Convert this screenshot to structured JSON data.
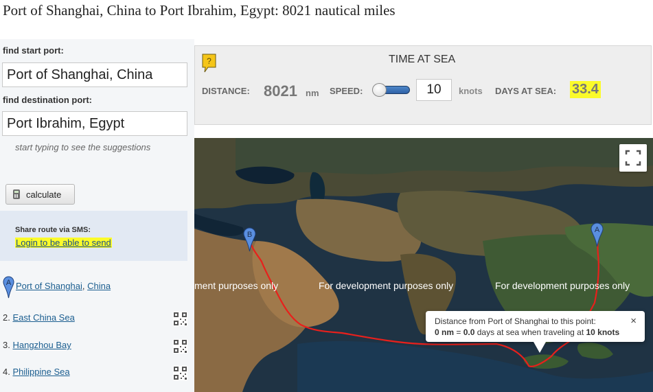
{
  "header": {
    "title": "Port of Shanghai, China to Port Ibrahim, Egypt: 8021 nautical miles"
  },
  "sidebar": {
    "start_label": "find start port:",
    "start_value": "Port of Shanghai, China",
    "destination_label": "find destination port:",
    "destination_value": "Port Ibrahim, Egypt",
    "hint": "start typing to see the suggestions",
    "calculate_label": "calculate",
    "sms_title": "Share route via SMS:",
    "sms_link": "Login to be able to send"
  },
  "route": {
    "start": {
      "marker": "A",
      "port": "Port of Shanghai",
      "separator": ", ",
      "country": "China"
    },
    "waypoints": [
      {
        "number": "2.",
        "name": "East China Sea"
      },
      {
        "number": "3.",
        "name": "Hangzhou Bay"
      },
      {
        "number": "4.",
        "name": "Philippine Sea"
      }
    ]
  },
  "time_panel": {
    "help_glyph": "?",
    "title": "TIME AT SEA",
    "distance_label": "DISTANCE:",
    "distance_value": "8021",
    "distance_unit": "nm",
    "speed_label": "SPEED:",
    "speed_value": "10",
    "speed_unit": "knots",
    "days_label": "DAYS AT SEA:",
    "days_value": "33.4",
    "highlight_color": "#fbfb2a"
  },
  "map": {
    "watermarks": [
      "ment purposes only",
      "For development purposes only",
      "For development purposes only"
    ],
    "marker_a": "A",
    "marker_b": "B",
    "route_color": "#e8201c",
    "tooltip": {
      "line1": "Distance from Port of Shanghai to this point:",
      "nm_value": "0 nm",
      "equals": " = ",
      "days_value": "0.0",
      "mid_text": " days at sea when traveling at ",
      "speed_value": "10 knots",
      "close": "×"
    }
  },
  "icons": {
    "help": "help-badge-icon",
    "calculate": "calculator-icon",
    "waypoint": "qr-code-icon",
    "fullscreen": "fullscreen-icon",
    "marker": "map-pin-icon"
  }
}
